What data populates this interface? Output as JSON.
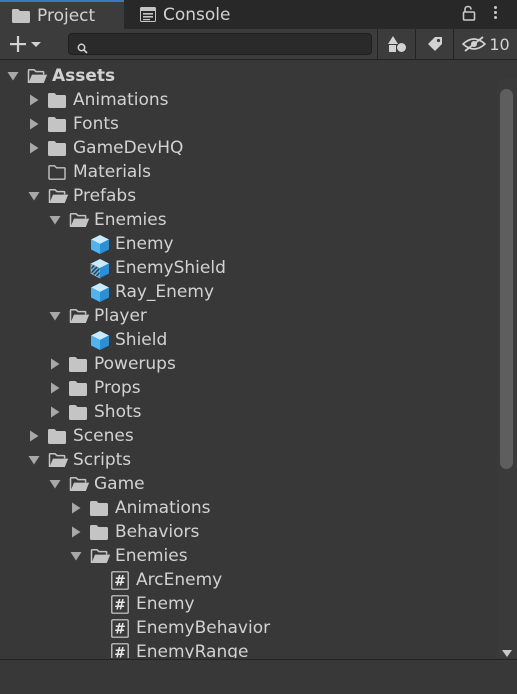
{
  "tabs": {
    "project": "Project",
    "console": "Console"
  },
  "toolbar": {
    "search_placeholder": "",
    "hidden_count": "10"
  },
  "tree": [
    {
      "label": "Assets",
      "depth": 0,
      "icon": "folder-open",
      "arrow": "down",
      "bold": true
    },
    {
      "label": "Animations",
      "depth": 1,
      "icon": "folder",
      "arrow": "right"
    },
    {
      "label": "Fonts",
      "depth": 1,
      "icon": "folder",
      "arrow": "right"
    },
    {
      "label": "GameDevHQ",
      "depth": 1,
      "icon": "folder",
      "arrow": "right"
    },
    {
      "label": "Materials",
      "depth": 1,
      "icon": "folder-empty",
      "arrow": "none"
    },
    {
      "label": "Prefabs",
      "depth": 1,
      "icon": "folder-open",
      "arrow": "down"
    },
    {
      "label": "Enemies",
      "depth": 2,
      "icon": "folder-open",
      "arrow": "down"
    },
    {
      "label": "Enemy",
      "depth": 3,
      "icon": "prefab",
      "arrow": "none"
    },
    {
      "label": "EnemyShield",
      "depth": 3,
      "icon": "prefab-variant",
      "arrow": "none"
    },
    {
      "label": "Ray_Enemy",
      "depth": 3,
      "icon": "prefab",
      "arrow": "none"
    },
    {
      "label": "Player",
      "depth": 2,
      "icon": "folder-open",
      "arrow": "down"
    },
    {
      "label": "Shield",
      "depth": 3,
      "icon": "prefab",
      "arrow": "none"
    },
    {
      "label": "Powerups",
      "depth": 2,
      "icon": "folder",
      "arrow": "right"
    },
    {
      "label": "Props",
      "depth": 2,
      "icon": "folder",
      "arrow": "right"
    },
    {
      "label": "Shots",
      "depth": 2,
      "icon": "folder",
      "arrow": "right"
    },
    {
      "label": "Scenes",
      "depth": 1,
      "icon": "folder",
      "arrow": "right"
    },
    {
      "label": "Scripts",
      "depth": 1,
      "icon": "folder-open",
      "arrow": "down"
    },
    {
      "label": "Game",
      "depth": 2,
      "icon": "folder-open",
      "arrow": "down"
    },
    {
      "label": "Animations",
      "depth": 3,
      "icon": "folder",
      "arrow": "right"
    },
    {
      "label": "Behaviors",
      "depth": 3,
      "icon": "folder",
      "arrow": "right"
    },
    {
      "label": "Enemies",
      "depth": 3,
      "icon": "folder-open",
      "arrow": "down"
    },
    {
      "label": "ArcEnemy",
      "depth": 4,
      "icon": "script",
      "arrow": "none"
    },
    {
      "label": "Enemy",
      "depth": 4,
      "icon": "script",
      "arrow": "none"
    },
    {
      "label": "EnemyBehavior",
      "depth": 4,
      "icon": "script",
      "arrow": "none"
    },
    {
      "label": "EnemyRange",
      "depth": 4,
      "icon": "script",
      "arrow": "none"
    }
  ]
}
